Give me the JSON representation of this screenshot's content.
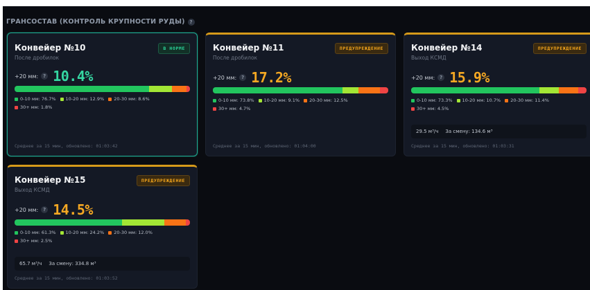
{
  "section": {
    "title": "ГРАНСОСТАВ (КОНТРОЛЬ КРУПНОСТИ РУДЫ)",
    "help_icon": "?"
  },
  "colors": {
    "fine": "#22c55e",
    "small": "#a3e635",
    "medium": "#f97316",
    "coarse": "#ef4444",
    "ok": "#35d7a2",
    "warn": "#f4a823"
  },
  "cards": [
    {
      "title": "Конвейер №10",
      "subtitle": "После дробилок",
      "badge": "В НОРМЕ",
      "status": "ok",
      "metric_label": "+20 мм:",
      "help": "?",
      "value": "10.4%",
      "fractions": [
        76.7,
        12.9,
        8.6,
        1.8
      ],
      "legend": [
        "0-10 мм: 76.7%",
        "10-20 мм: 12.9%",
        "20-30 мм: 8.6%",
        "30+ мм: 1.8%"
      ],
      "flow": null,
      "shift": null,
      "footer": "Среднее за 15 мин, обновлено: 01:03:42"
    },
    {
      "title": "Конвейер №11",
      "subtitle": "После дробилок",
      "badge": "ПРЕДУПРЕЖДЕНИЕ",
      "status": "warn",
      "metric_label": "+20 мм:",
      "help": "?",
      "value": "17.2%",
      "fractions": [
        73.8,
        9.1,
        12.5,
        4.7
      ],
      "legend": [
        "0-10 мм: 73.8%",
        "10-20 мм: 9.1%",
        "20-30 мм: 12.5%",
        "30+ мм: 4.7%"
      ],
      "flow": null,
      "shift": null,
      "footer": "Среднее за 15 мин, обновлено: 01:04:00"
    },
    {
      "title": "Конвейер №14",
      "subtitle": "Выход КСМД",
      "badge": "ПРЕДУПРЕЖДЕНИЕ",
      "status": "warn",
      "metric_label": "+20 мм:",
      "help": "?",
      "value": "15.9%",
      "fractions": [
        73.3,
        10.7,
        11.4,
        4.5
      ],
      "legend": [
        "0-10 мм: 73.3%",
        "10-20 мм: 10.7%",
        "20-30 мм: 11.4%",
        "30+ мм: 4.5%"
      ],
      "flow": "29.5 м³/ч",
      "shift": "За смену: 134.6 м³",
      "footer": "Среднее за 15 мин, обновлено: 01:03:31"
    },
    {
      "title": "Конвейер №15",
      "subtitle": "Выход КСМД",
      "badge": "ПРЕДУПРЕЖДЕНИЕ",
      "status": "warn",
      "metric_label": "+20 мм:",
      "help": "?",
      "value": "14.5%",
      "fractions": [
        61.3,
        24.2,
        12.0,
        2.5
      ],
      "legend": [
        "0-10 мм: 61.3%",
        "10-20 мм: 24.2%",
        "20-30 мм: 12.0%",
        "30+ мм: 2.5%"
      ],
      "flow": "65.7 м³/ч",
      "shift": "За смену: 334.8 м³",
      "footer": "Среднее за 15 мин, обновлено: 01:03:52"
    }
  ]
}
